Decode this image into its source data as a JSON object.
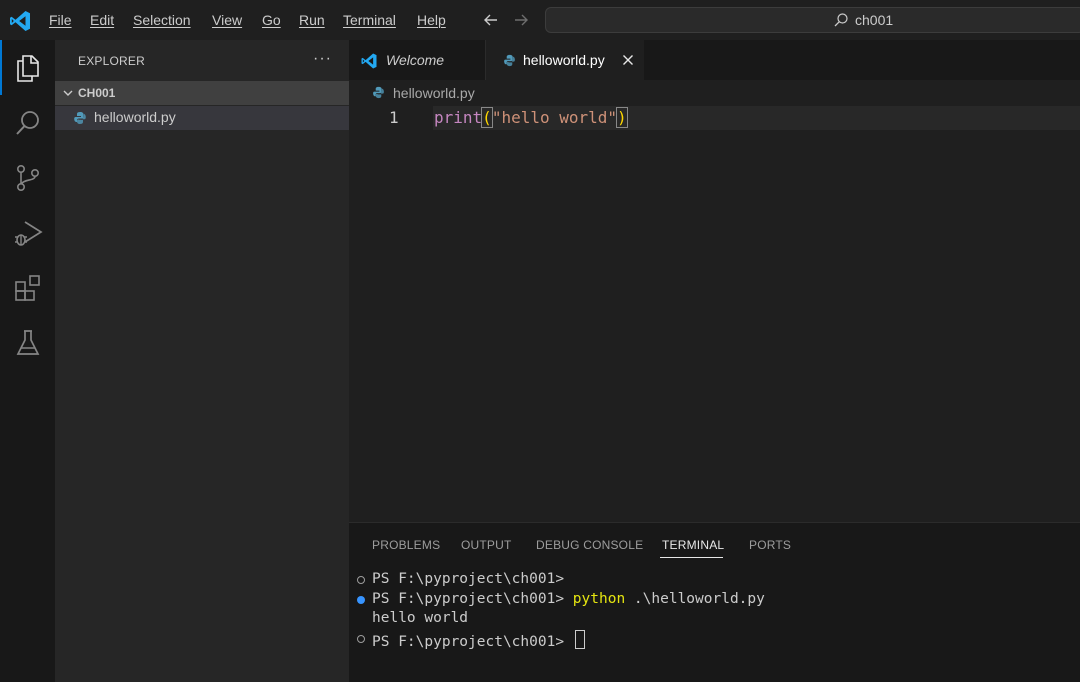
{
  "menubar": {
    "items": [
      "File",
      "Edit",
      "Selection",
      "View",
      "Go",
      "Run",
      "Terminal",
      "Help"
    ]
  },
  "command_center": {
    "label": "ch001"
  },
  "activity_bar": {
    "icons": [
      "explorer-icon",
      "search-icon",
      "source-control-icon",
      "run-debug-icon",
      "extensions-icon",
      "testing-icon"
    ]
  },
  "sidebar": {
    "title": "EXPLORER",
    "more": "···",
    "folder": "CH001",
    "file": "helloworld.py"
  },
  "tabs": [
    {
      "label": "Welcome"
    },
    {
      "label": "helloworld.py"
    }
  ],
  "breadcrumb": {
    "label": "helloworld.py"
  },
  "editor": {
    "line_number": "1",
    "code": {
      "fn": "print",
      "open": "(",
      "str": "\"hello world\"",
      "close": ")"
    }
  },
  "panel": {
    "tabs": [
      "PROBLEMS",
      "OUTPUT",
      "DEBUG CONSOLE",
      "TERMINAL",
      "PORTS"
    ],
    "active_tab": "TERMINAL",
    "terminal": {
      "line1": "PS F:\\pyproject\\ch001>",
      "line2_prompt": "PS F:\\pyproject\\ch001> ",
      "line2_cmd": "python",
      "line2_arg": " .\\helloworld.py",
      "line3": "hello world",
      "line4": "PS F:\\pyproject\\ch001> "
    }
  },
  "colors": {
    "accent": "#0078d4",
    "python_icon": "#519aba",
    "vscode_logo": "#23a9f2"
  }
}
